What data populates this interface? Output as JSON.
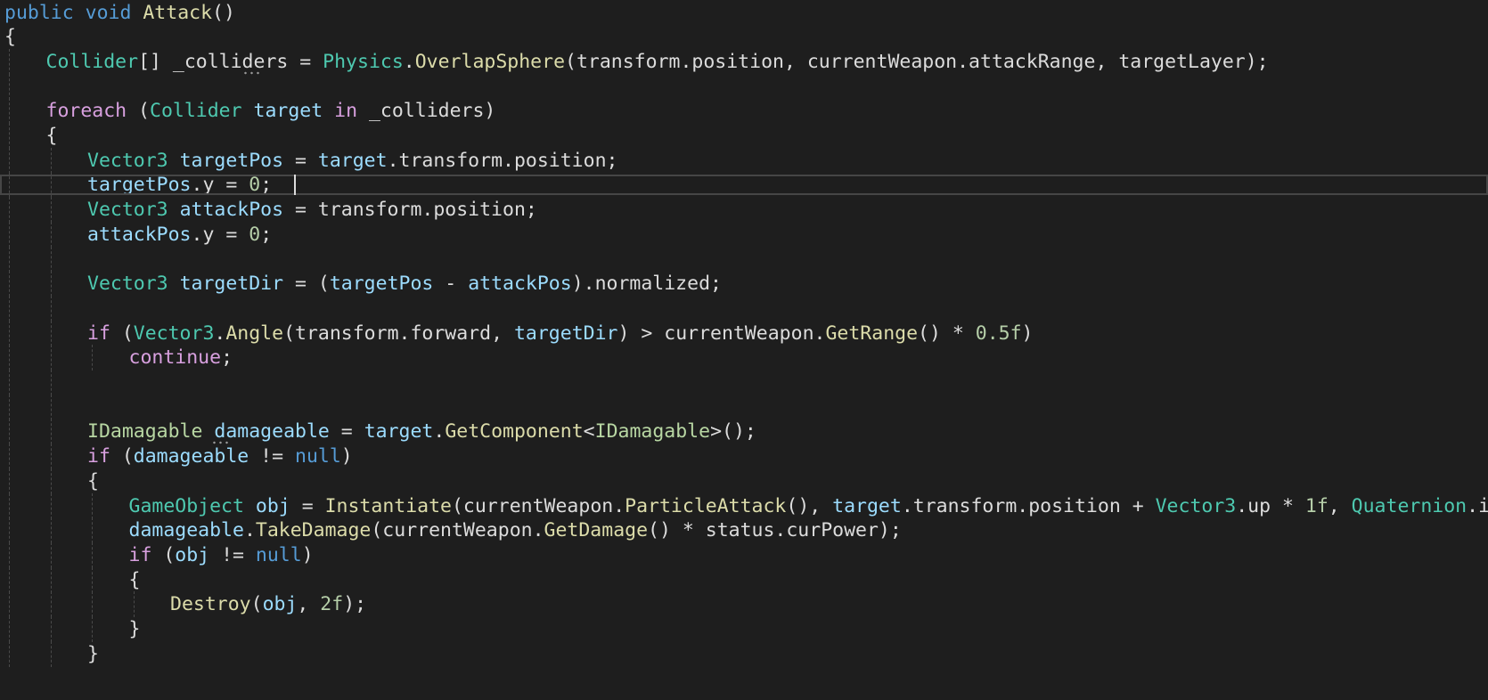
{
  "editor": {
    "lines": [
      {
        "indent": 0,
        "tokens": [
          {
            "t": "kw",
            "v": "public"
          },
          {
            "t": "txt",
            "v": " "
          },
          {
            "t": "kw",
            "v": "void"
          },
          {
            "t": "txt",
            "v": " "
          },
          {
            "t": "mth",
            "v": "Attack"
          },
          {
            "t": "txt",
            "v": "()"
          }
        ]
      },
      {
        "indent": 0,
        "tokens": [
          {
            "t": "txt",
            "v": "{"
          }
        ]
      },
      {
        "indent": 1,
        "tokens": [
          {
            "t": "type",
            "v": "Collider"
          },
          {
            "t": "txt",
            "v": "[] _colliders = "
          },
          {
            "t": "type",
            "v": "Physics"
          },
          {
            "t": "txt",
            "v": "."
          },
          {
            "t": "mth",
            "v": "OverlapSphere"
          },
          {
            "t": "txt",
            "v": "(transform.position, currentWeapon.attackRange, targetLayer);"
          }
        ]
      },
      {
        "indent": 1,
        "tokens": []
      },
      {
        "indent": 1,
        "tokens": [
          {
            "t": "ctl",
            "v": "foreach"
          },
          {
            "t": "txt",
            "v": " ("
          },
          {
            "t": "type",
            "v": "Collider"
          },
          {
            "t": "txt",
            "v": " "
          },
          {
            "t": "var",
            "v": "target"
          },
          {
            "t": "txt",
            "v": " "
          },
          {
            "t": "ctl",
            "v": "in"
          },
          {
            "t": "txt",
            "v": " _colliders)"
          }
        ]
      },
      {
        "indent": 1,
        "tokens": [
          {
            "t": "txt",
            "v": "{"
          }
        ]
      },
      {
        "indent": 2,
        "tokens": [
          {
            "t": "type",
            "v": "Vector3"
          },
          {
            "t": "txt",
            "v": " "
          },
          {
            "t": "var",
            "v": "targetPos"
          },
          {
            "t": "txt",
            "v": " = "
          },
          {
            "t": "var",
            "v": "target"
          },
          {
            "t": "txt",
            "v": ".transform.position;"
          }
        ]
      },
      {
        "indent": 2,
        "tokens": [
          {
            "t": "var",
            "v": "targetPos"
          },
          {
            "t": "txt",
            "v": ".y = "
          },
          {
            "t": "num",
            "v": "0"
          },
          {
            "t": "txt",
            "v": ";"
          }
        ]
      },
      {
        "indent": 2,
        "tokens": [
          {
            "t": "type",
            "v": "Vector3"
          },
          {
            "t": "txt",
            "v": " "
          },
          {
            "t": "var",
            "v": "attackPos"
          },
          {
            "t": "txt",
            "v": " = transform.position;"
          }
        ]
      },
      {
        "indent": 2,
        "tokens": [
          {
            "t": "var",
            "v": "attackPos"
          },
          {
            "t": "txt",
            "v": ".y = "
          },
          {
            "t": "num",
            "v": "0"
          },
          {
            "t": "txt",
            "v": ";"
          }
        ]
      },
      {
        "indent": 2,
        "tokens": []
      },
      {
        "indent": 2,
        "tokens": [
          {
            "t": "type",
            "v": "Vector3"
          },
          {
            "t": "txt",
            "v": " "
          },
          {
            "t": "var",
            "v": "targetDir"
          },
          {
            "t": "txt",
            "v": " = ("
          },
          {
            "t": "var",
            "v": "targetPos"
          },
          {
            "t": "txt",
            "v": " - "
          },
          {
            "t": "var",
            "v": "attackPos"
          },
          {
            "t": "txt",
            "v": ").normalized;"
          }
        ]
      },
      {
        "indent": 2,
        "tokens": []
      },
      {
        "indent": 2,
        "tokens": [
          {
            "t": "ctl",
            "v": "if"
          },
          {
            "t": "txt",
            "v": " ("
          },
          {
            "t": "type",
            "v": "Vector3"
          },
          {
            "t": "txt",
            "v": "."
          },
          {
            "t": "mth",
            "v": "Angle"
          },
          {
            "t": "txt",
            "v": "(transform.forward, "
          },
          {
            "t": "var",
            "v": "targetDir"
          },
          {
            "t": "txt",
            "v": ") > currentWeapon."
          },
          {
            "t": "mth",
            "v": "GetRange"
          },
          {
            "t": "txt",
            "v": "() * "
          },
          {
            "t": "num",
            "v": "0.5f"
          },
          {
            "t": "txt",
            "v": ")"
          }
        ]
      },
      {
        "indent": 3,
        "tokens": [
          {
            "t": "ctl",
            "v": "continue"
          },
          {
            "t": "txt",
            "v": ";"
          }
        ]
      },
      {
        "indent": 2,
        "tokens": []
      },
      {
        "indent": 2,
        "tokens": []
      },
      {
        "indent": 2,
        "tokens": [
          {
            "t": "iface",
            "v": "IDamagable"
          },
          {
            "t": "txt",
            "v": " "
          },
          {
            "t": "var",
            "v": "damageable"
          },
          {
            "t": "txt",
            "v": " = "
          },
          {
            "t": "var",
            "v": "target"
          },
          {
            "t": "txt",
            "v": "."
          },
          {
            "t": "mth",
            "v": "GetComponent"
          },
          {
            "t": "txt",
            "v": "<"
          },
          {
            "t": "iface",
            "v": "IDamagable"
          },
          {
            "t": "txt",
            "v": ">();"
          }
        ]
      },
      {
        "indent": 2,
        "tokens": [
          {
            "t": "ctl",
            "v": "if"
          },
          {
            "t": "txt",
            "v": " ("
          },
          {
            "t": "var",
            "v": "damageable"
          },
          {
            "t": "txt",
            "v": " != "
          },
          {
            "t": "kw",
            "v": "null"
          },
          {
            "t": "txt",
            "v": ")"
          }
        ]
      },
      {
        "indent": 2,
        "tokens": [
          {
            "t": "txt",
            "v": "{"
          }
        ]
      },
      {
        "indent": 3,
        "tokens": [
          {
            "t": "type",
            "v": "GameObject"
          },
          {
            "t": "txt",
            "v": " "
          },
          {
            "t": "var",
            "v": "obj"
          },
          {
            "t": "txt",
            "v": " = "
          },
          {
            "t": "mth",
            "v": "Instantiate"
          },
          {
            "t": "txt",
            "v": "(currentWeapon."
          },
          {
            "t": "mth",
            "v": "ParticleAttack"
          },
          {
            "t": "txt",
            "v": "(), "
          },
          {
            "t": "var",
            "v": "target"
          },
          {
            "t": "txt",
            "v": ".transform.position + "
          },
          {
            "t": "type",
            "v": "Vector3"
          },
          {
            "t": "txt",
            "v": ".up * "
          },
          {
            "t": "num",
            "v": "1f"
          },
          {
            "t": "txt",
            "v": ", "
          },
          {
            "t": "type",
            "v": "Quaternion"
          },
          {
            "t": "txt",
            "v": ".identity);"
          }
        ]
      },
      {
        "indent": 3,
        "tokens": [
          {
            "t": "var",
            "v": "damageable"
          },
          {
            "t": "txt",
            "v": "."
          },
          {
            "t": "mth",
            "v": "TakeDamage"
          },
          {
            "t": "txt",
            "v": "(currentWeapon."
          },
          {
            "t": "mth",
            "v": "GetDamage"
          },
          {
            "t": "txt",
            "v": "() * status.curPower);"
          }
        ]
      },
      {
        "indent": 3,
        "tokens": [
          {
            "t": "ctl",
            "v": "if"
          },
          {
            "t": "txt",
            "v": " ("
          },
          {
            "t": "var",
            "v": "obj"
          },
          {
            "t": "txt",
            "v": " != "
          },
          {
            "t": "kw",
            "v": "null"
          },
          {
            "t": "txt",
            "v": ")"
          }
        ]
      },
      {
        "indent": 3,
        "tokens": [
          {
            "t": "txt",
            "v": "{"
          }
        ]
      },
      {
        "indent": 4,
        "tokens": [
          {
            "t": "mth",
            "v": "Destroy"
          },
          {
            "t": "txt",
            "v": "("
          },
          {
            "t": "var",
            "v": "obj"
          },
          {
            "t": "txt",
            "v": ", "
          },
          {
            "t": "num",
            "v": "2f"
          },
          {
            "t": "txt",
            "v": ");"
          }
        ]
      },
      {
        "indent": 3,
        "tokens": [
          {
            "t": "txt",
            "v": "}"
          }
        ]
      },
      {
        "indent": 2,
        "tokens": [
          {
            "t": "txt",
            "v": "}"
          }
        ]
      }
    ],
    "current_line": 8,
    "caret": {
      "line": 8,
      "column": 20
    },
    "squiggles": [
      {
        "line": 3,
        "column": 19
      },
      {
        "line": 18,
        "column": 12
      }
    ],
    "colors": {
      "background": "#1e1e1e",
      "keyword": "#569cd6",
      "control": "#d8a0df",
      "type": "#4ec9b0",
      "interface": "#b8d7a3",
      "method": "#dcdcaa",
      "variable": "#9cdcfe",
      "number": "#b5cea8",
      "text": "#dcdcdc"
    }
  }
}
